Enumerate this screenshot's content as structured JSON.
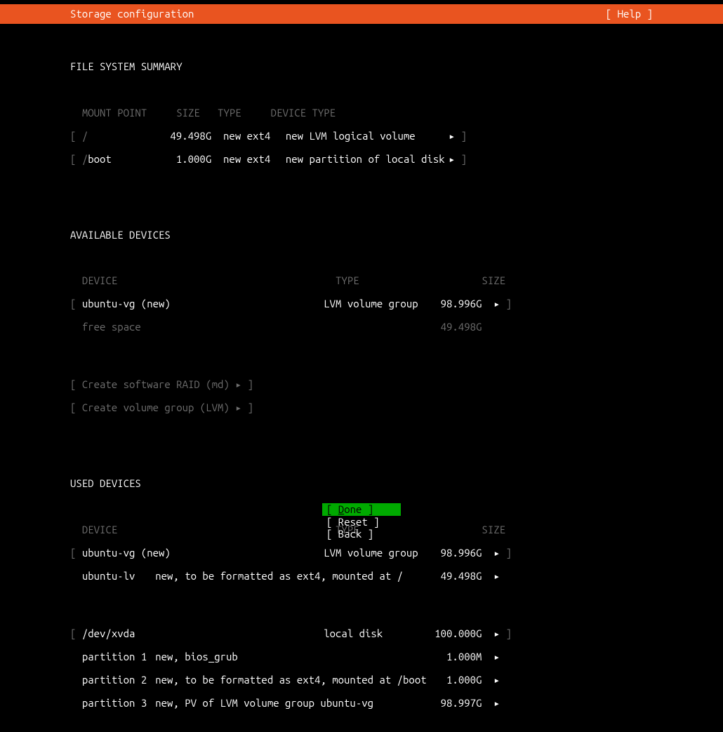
{
  "topbar": {
    "title": "Storage configuration",
    "help": "[ Help ]"
  },
  "headings": {
    "file_system_summary": "FILE SYSTEM SUMMARY",
    "available_devices": "AVAILABLE DEVICES",
    "used_devices": "USED DEVICES"
  },
  "fs_header": {
    "mount_point": "MOUNT POINT",
    "size": "SIZE",
    "type": "TYPE",
    "device_type": "DEVICE TYPE"
  },
  "fs_rows": [
    {
      "lb": "[ ",
      "mp": "/",
      "size": "49.498G",
      "type": "new ext4",
      "dtype": "new LVM logical volume",
      "arrow": "▸",
      "rb": " ]"
    },
    {
      "lb": "[ ",
      "mp": "/boot",
      "size": "1.000G",
      "type": "new ext4",
      "dtype": "new partition of local disk",
      "arrow": "▸",
      "rb": " ]"
    }
  ],
  "dev_header": {
    "device": "DEVICE",
    "type": "TYPE",
    "size": "SIZE"
  },
  "available": {
    "row0": {
      "lb": "[ ",
      "name": "ubuntu-vg (new)",
      "type": "LVM volume group",
      "size": "98.996G",
      "arrow": "▸",
      "rb": " ]"
    },
    "row1": {
      "name": "free space",
      "size": "49.498G"
    }
  },
  "create_actions": {
    "raid": "[ Create software RAID (md) ▸ ]",
    "lvm": "[ Create volume group (LVM) ▸ ]"
  },
  "used": {
    "vg": {
      "lb": "[ ",
      "name": "ubuntu-vg (new)",
      "type": "LVM volume group",
      "size": "98.996G",
      "arrow": "▸",
      "rb": " ]"
    },
    "lv": {
      "name": "ubuntu-lv",
      "desc": "new, to be formatted as ext4, mounted at /",
      "size": "49.498G",
      "arrow": "▸"
    },
    "disk": {
      "lb": "[ ",
      "name": "/dev/xvda",
      "type": "local disk",
      "size": "100.000G",
      "arrow": "▸",
      "rb": " ]"
    },
    "p1": {
      "name": "partition 1",
      "desc": "new, bios_grub",
      "size": "1.000M",
      "arrow": "▸"
    },
    "p2": {
      "name": "partition 2",
      "desc": "new, to be formatted as ext4, mounted at /boot",
      "size": "1.000G",
      "arrow": "▸"
    },
    "p3": {
      "name": "partition 3",
      "desc": "new, PV of LVM volume group ubuntu-vg",
      "size": "98.997G",
      "arrow": "▸"
    }
  },
  "footer": {
    "done_pre": "[ ",
    "done_letter": "D",
    "done_rest": "one",
    "done_post": "      ]",
    "reset": "[ Reset     ]",
    "back": "[ Back      ]"
  }
}
